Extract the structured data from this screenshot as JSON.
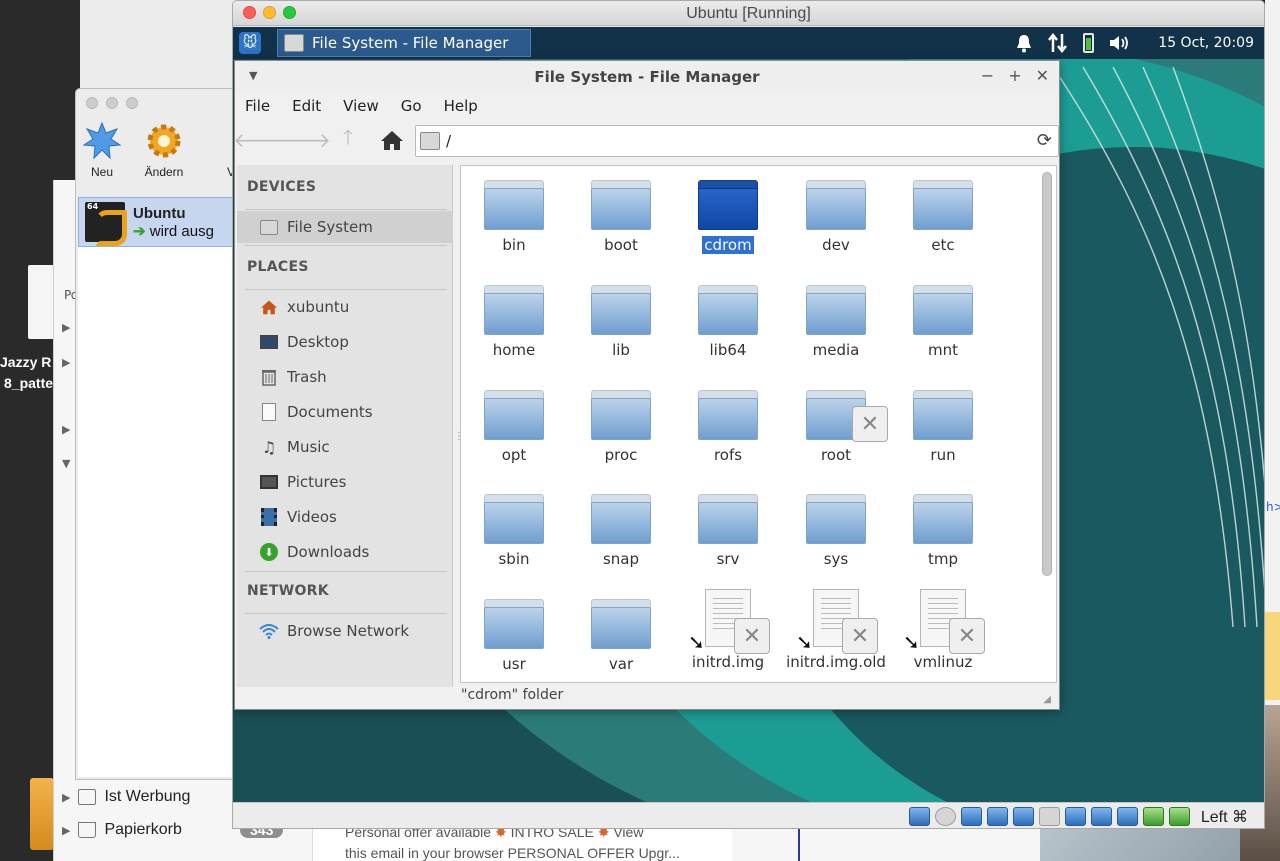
{
  "mac_left": {
    "lines": [
      "Jazzy R",
      "8_patte"
    ]
  },
  "mail": {
    "folders": [
      {
        "label": "Ist Werbung"
      },
      {
        "label": "Papierkorb",
        "badge": "343"
      }
    ],
    "preview_line1": "Personal offer available",
    "preview_sale": "INTRO SALE",
    "preview_view": "View",
    "preview_line2": "this email in your browser PERSONAL OFFER Upgr..."
  },
  "vbox_manager": {
    "tools": [
      {
        "label": "Neu",
        "icon": "new-star-icon"
      },
      {
        "label": "Ändern",
        "icon": "gear-icon"
      },
      {
        "label": "Ve",
        "icon": "discard-icon"
      }
    ],
    "vm": {
      "name": "Ubuntu",
      "state": "wird ausg",
      "badge": "64"
    }
  },
  "vm_window": {
    "title": "Ubuntu [Running]",
    "colors": {
      "close": "#fc5f57",
      "minimize": "#fdbc2e",
      "zoom": "#28c840"
    }
  },
  "xfce_panel": {
    "task_label": "File System - File Manager",
    "clock": "15 Oct, 20:09"
  },
  "file_manager": {
    "title": "File System - File Manager",
    "menu": [
      "File",
      "Edit",
      "View",
      "Go",
      "Help"
    ],
    "path": "/",
    "sidebar": {
      "devices_heading": "DEVICES",
      "devices": [
        {
          "label": "File System",
          "icon": "drive-icon",
          "selected": true
        }
      ],
      "places_heading": "PLACES",
      "places": [
        {
          "label": "xubuntu",
          "icon": "home-icon"
        },
        {
          "label": "Desktop",
          "icon": "desktop-icon"
        },
        {
          "label": "Trash",
          "icon": "trash-icon"
        },
        {
          "label": "Documents",
          "icon": "document-icon"
        },
        {
          "label": "Music",
          "icon": "music-icon"
        },
        {
          "label": "Pictures",
          "icon": "pictures-icon"
        },
        {
          "label": "Videos",
          "icon": "videos-icon"
        },
        {
          "label": "Downloads",
          "icon": "downloads-icon"
        }
      ],
      "network_heading": "NETWORK",
      "network": [
        {
          "label": "Browse Network",
          "icon": "wifi-icon"
        }
      ]
    },
    "items": [
      {
        "name": "bin",
        "type": "folder"
      },
      {
        "name": "boot",
        "type": "folder"
      },
      {
        "name": "cdrom",
        "type": "folder",
        "selected": true
      },
      {
        "name": "dev",
        "type": "folder"
      },
      {
        "name": "etc",
        "type": "folder"
      },
      {
        "name": "home",
        "type": "folder"
      },
      {
        "name": "lib",
        "type": "folder"
      },
      {
        "name": "lib64",
        "type": "folder"
      },
      {
        "name": "media",
        "type": "folder"
      },
      {
        "name": "mnt",
        "type": "folder"
      },
      {
        "name": "opt",
        "type": "folder"
      },
      {
        "name": "proc",
        "type": "folder"
      },
      {
        "name": "rofs",
        "type": "folder"
      },
      {
        "name": "root",
        "type": "folder",
        "locked": true
      },
      {
        "name": "run",
        "type": "folder"
      },
      {
        "name": "sbin",
        "type": "folder"
      },
      {
        "name": "snap",
        "type": "folder"
      },
      {
        "name": "srv",
        "type": "folder"
      },
      {
        "name": "sys",
        "type": "folder"
      },
      {
        "name": "tmp",
        "type": "folder"
      },
      {
        "name": "usr",
        "type": "folder"
      },
      {
        "name": "var",
        "type": "folder"
      },
      {
        "name": "initrd.img",
        "type": "broken-link"
      },
      {
        "name": "initrd.img.old",
        "type": "broken-link"
      },
      {
        "name": "vmlinuz",
        "type": "broken-link"
      }
    ],
    "status": "\"cdrom\" folder",
    "colors": {
      "selection": "#2f6fd6"
    }
  },
  "vm_statusbar": {
    "host_key": "Left ⌘"
  }
}
